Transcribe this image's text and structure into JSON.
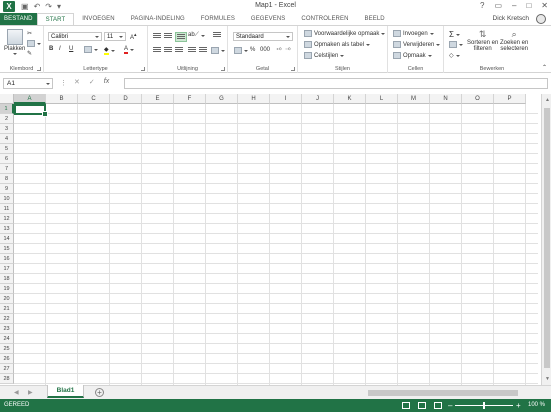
{
  "app": {
    "title": "Map1 - Excel",
    "user": "Dick Kretsch"
  },
  "tabs": [
    "BESTAND",
    "START",
    "INVOEGEN",
    "PAGINA-INDELING",
    "FORMULES",
    "GEGEVENS",
    "CONTROLEREN",
    "BEELD"
  ],
  "ribbon": {
    "clipboard": {
      "paste": "Plakken",
      "label": "Klembord"
    },
    "font": {
      "name": "Calibri",
      "size": "11",
      "label": "Lettertype",
      "bold": "B",
      "italic": "I",
      "underline": "U"
    },
    "alignment": {
      "label": "Uitlijning"
    },
    "number": {
      "format": "Standaard",
      "label": "Getal"
    },
    "styles": {
      "conditional": "Voorwaardelijke opmaak",
      "as_table": "Opmaken als tabel",
      "cell_styles": "Celstijlen",
      "label": "Stijlen"
    },
    "cells": {
      "insert": "Invoegen",
      "delete": "Verwijderen",
      "format": "Opmaak",
      "label": "Cellen"
    },
    "editing": {
      "sort_filter_1": "Sorteren en",
      "sort_filter_2": "filteren",
      "find_1": "Zoeken en",
      "find_2": "selecteren",
      "label": "Bewerken"
    }
  },
  "formula_bar": {
    "name_box": "A1",
    "fx": "fx",
    "value": ""
  },
  "grid": {
    "columns": [
      "A",
      "B",
      "C",
      "D",
      "E",
      "F",
      "G",
      "H",
      "I",
      "J",
      "K",
      "L",
      "M",
      "N",
      "O",
      "P"
    ],
    "rows": [
      "1",
      "2",
      "3",
      "4",
      "5",
      "6",
      "7",
      "8",
      "9",
      "10",
      "11",
      "12",
      "13",
      "14",
      "15",
      "16",
      "17",
      "18",
      "19",
      "20",
      "21",
      "22",
      "23",
      "24",
      "25",
      "26",
      "27",
      "28"
    ],
    "active_cell": "A1"
  },
  "sheets": {
    "tabs": [
      "Blad1"
    ],
    "add": "+"
  },
  "status": {
    "ready": "GEREED",
    "zoom": "100 %"
  },
  "colors": {
    "accent": "#217346"
  }
}
